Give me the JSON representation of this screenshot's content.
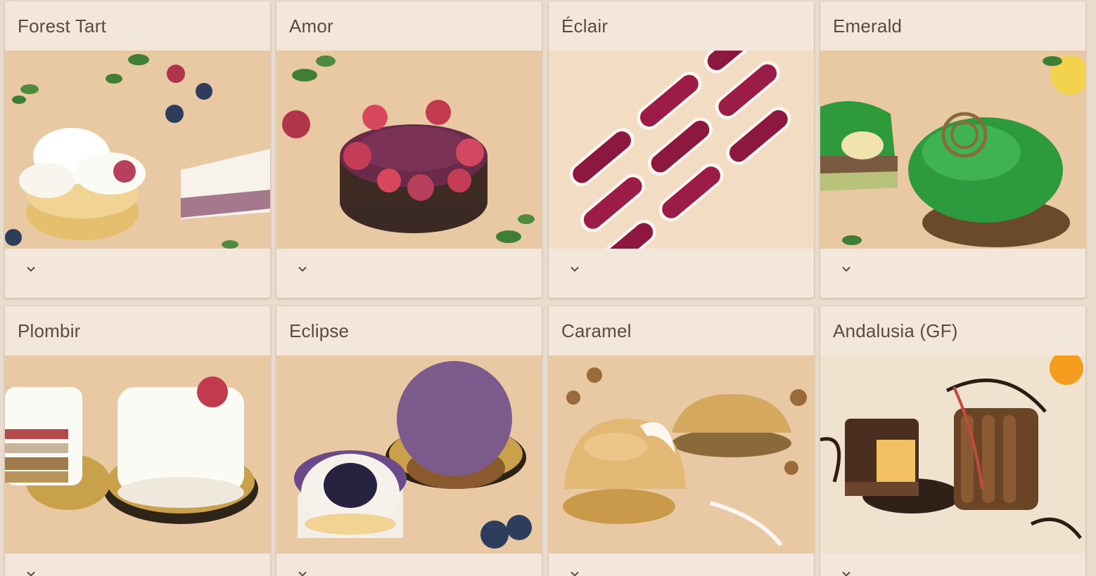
{
  "cards": [
    {
      "title": "Forest Tart",
      "image_alt": "Forest Tart",
      "expand_icon": "chevron-down-icon"
    },
    {
      "title": "Amor",
      "image_alt": "Amor",
      "expand_icon": "chevron-down-icon"
    },
    {
      "title": "Éclair",
      "image_alt": "Éclair",
      "expand_icon": "chevron-down-icon"
    },
    {
      "title": "Emerald",
      "image_alt": "Emerald",
      "expand_icon": "chevron-down-icon"
    },
    {
      "title": "Plombir",
      "image_alt": "Plombir",
      "expand_icon": "chevron-down-icon"
    },
    {
      "title": "Eclipse",
      "image_alt": "Eclipse",
      "expand_icon": "chevron-down-icon"
    },
    {
      "title": "Caramel",
      "image_alt": "Caramel",
      "expand_icon": "chevron-down-icon"
    },
    {
      "title": "Andalusia (GF)",
      "image_alt": "Andalusia (GF)",
      "expand_icon": "chevron-down-icon"
    }
  ],
  "colors": {
    "page_background": "#e9dccd",
    "card_background": "#f3e6da",
    "title_text": "#5a4b3f",
    "photo_backdrop": "#e8c9a3"
  }
}
